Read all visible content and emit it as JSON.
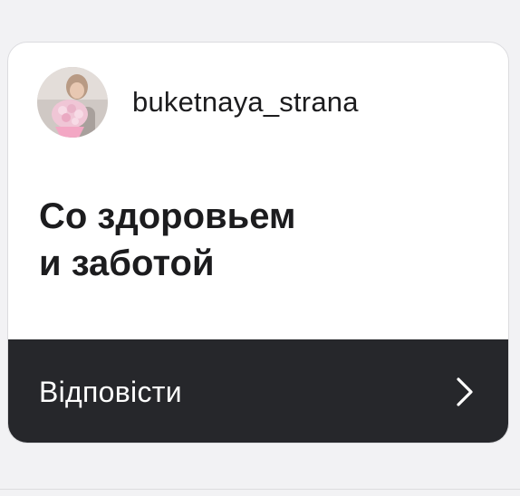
{
  "card": {
    "username": "buketnaya_strana",
    "message": "Со здоровьем\nи заботой",
    "reply_label": "Відповісти"
  },
  "icons": {
    "avatar": "profile-photo-woman-with-bouquet",
    "reply_chevron": "chevron-right-icon"
  },
  "colors": {
    "background": "#f2f2f4",
    "card": "#ffffff",
    "reply_bar": "#26272b",
    "text_dark": "#1c1c1e",
    "text_light": "#ffffff"
  }
}
